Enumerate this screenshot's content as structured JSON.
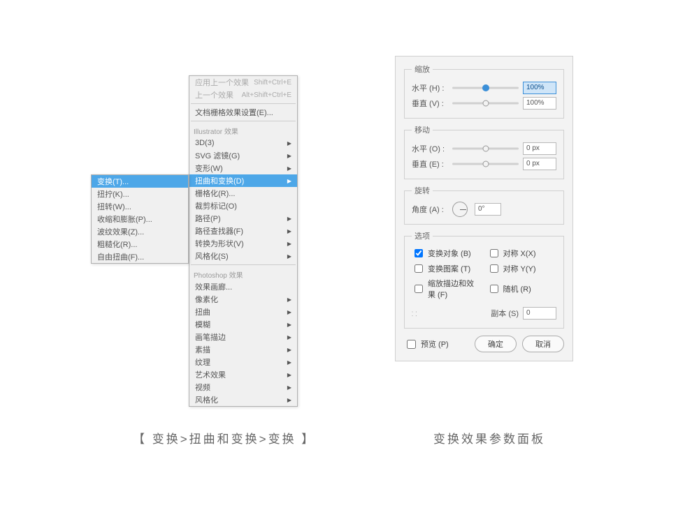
{
  "menu1": {
    "items": [
      {
        "label": "变换(T)..."
      },
      {
        "label": "扭拧(K)..."
      },
      {
        "label": "扭转(W)..."
      },
      {
        "label": "收缩和膨胀(P)..."
      },
      {
        "label": "波纹效果(Z)..."
      },
      {
        "label": "粗糙化(R)..."
      },
      {
        "label": "自由扭曲(F)..."
      }
    ]
  },
  "menu2": {
    "top1": {
      "label": "应用上一个效果",
      "shortcut": "Shift+Ctrl+E"
    },
    "top2": {
      "label": "上一个效果",
      "shortcut": "Alt+Shift+Ctrl+E"
    },
    "docRaster": "文档栅格效果设置(E)...",
    "section_ai": "Illustrator 效果",
    "ai": [
      {
        "label": "3D(3)",
        "sub": true
      },
      {
        "label": "SVG 滤镜(G)",
        "sub": true
      },
      {
        "label": "变形(W)",
        "sub": true
      },
      {
        "label": "扭曲和变换(D)",
        "sub": true,
        "hl": true
      },
      {
        "label": "栅格化(R)...",
        "sub": false
      },
      {
        "label": "裁剪标记(O)",
        "sub": false
      },
      {
        "label": "路径(P)",
        "sub": true
      },
      {
        "label": "路径查找器(F)",
        "sub": true
      },
      {
        "label": "转换为形状(V)",
        "sub": true
      },
      {
        "label": "风格化(S)",
        "sub": true
      }
    ],
    "section_ps": "Photoshop 效果",
    "ps": [
      {
        "label": "效果画廊...",
        "sub": false
      },
      {
        "label": "像素化",
        "sub": true
      },
      {
        "label": "扭曲",
        "sub": true
      },
      {
        "label": "模糊",
        "sub": true
      },
      {
        "label": "画笔描边",
        "sub": true
      },
      {
        "label": "素描",
        "sub": true
      },
      {
        "label": "纹理",
        "sub": true
      },
      {
        "label": "艺术效果",
        "sub": true
      },
      {
        "label": "视频",
        "sub": true
      },
      {
        "label": "风格化",
        "sub": true
      }
    ]
  },
  "panel": {
    "scale": {
      "legend": "缩放",
      "hLabel": "水平 (H) :",
      "hVal": "100%",
      "vLabel": "垂直 (V) :",
      "vVal": "100%"
    },
    "move": {
      "legend": "移动",
      "hLabel": "水平 (O) :",
      "hVal": "0 px",
      "vLabel": "垂直 (E) :",
      "vVal": "0 px"
    },
    "rotate": {
      "legend": "旋转",
      "aLabel": "角度 (A) :",
      "aVal": "0°"
    },
    "options": {
      "legend": "选项",
      "c1": "变换对象 (B)",
      "c2": "对称 X(X)",
      "c3": "变换图案 (T)",
      "c4": "对称 Y(Y)",
      "c5": "缩放描边和效果 (F)",
      "c6": "随机 (R)"
    },
    "copies": {
      "label": "副本 (S)",
      "val": "0"
    },
    "preview": "预览 (P)",
    "ok": "确定",
    "cancel": "取消"
  },
  "captions": {
    "left": "【 变换>扭曲和变换>变换 】",
    "right": "变换效果参数面板"
  }
}
